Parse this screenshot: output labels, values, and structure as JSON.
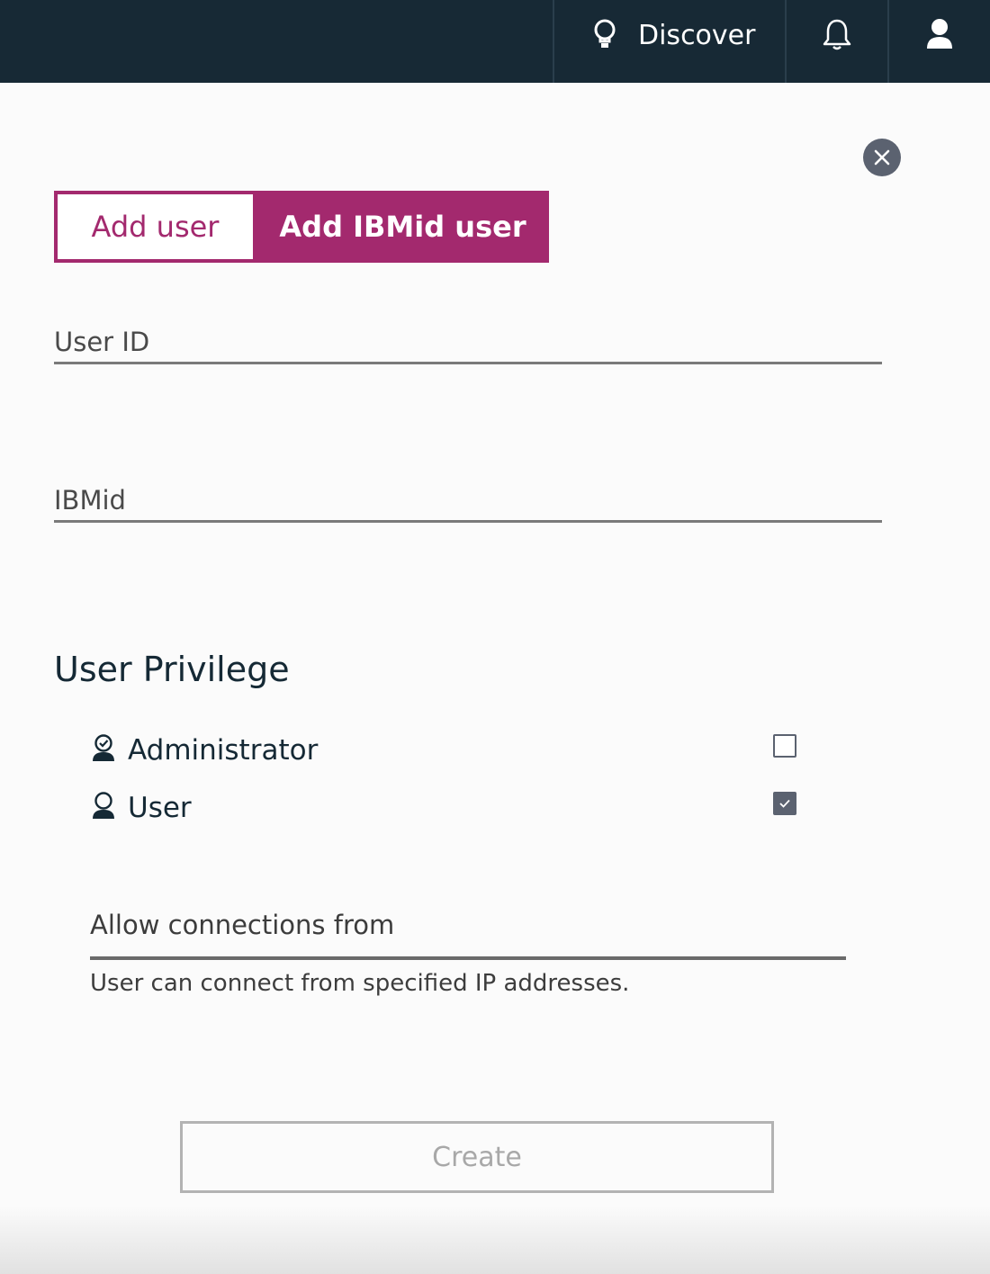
{
  "header": {
    "discover_label": "Discover",
    "bg_color": "#172935"
  },
  "tabs": [
    {
      "label": "Add user",
      "active": false
    },
    {
      "label": "Add IBMid user",
      "active": true
    }
  ],
  "form": {
    "user_id": {
      "placeholder": "User ID",
      "value": ""
    },
    "ibmid": {
      "placeholder": "IBMid",
      "value": ""
    }
  },
  "privilege": {
    "title": "User Privilege",
    "options": [
      {
        "label": "Administrator",
        "checked": false,
        "icon": "admin-user-icon"
      },
      {
        "label": "User",
        "checked": true,
        "icon": "user-icon"
      }
    ]
  },
  "connections": {
    "placeholder": "Allow connections from",
    "helper": "User can connect from specified IP addresses."
  },
  "actions": {
    "create_label": "Create",
    "create_disabled": true
  },
  "colors": {
    "accent": "#a3296e",
    "checkbox": "#5b6270"
  }
}
